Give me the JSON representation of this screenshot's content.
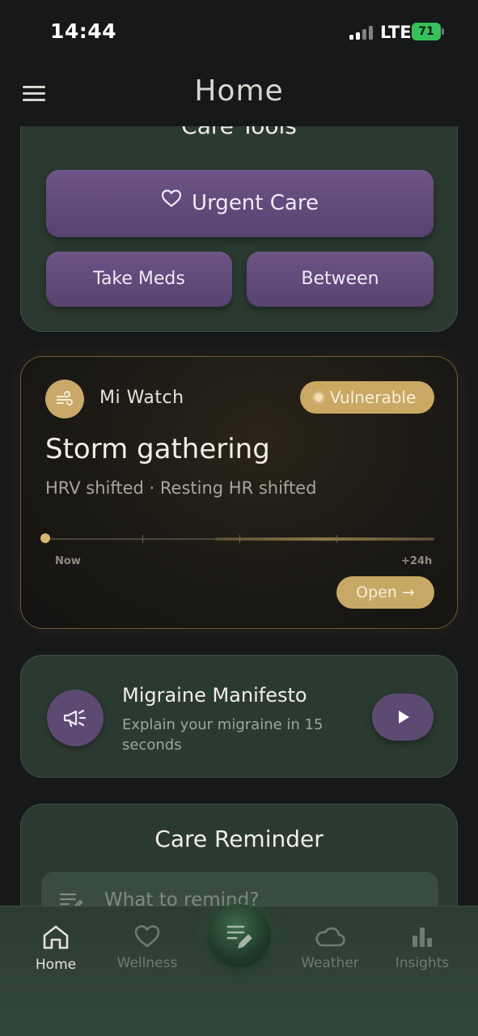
{
  "status_bar": {
    "time": "14:44",
    "network": "LTE",
    "battery": "71"
  },
  "header": {
    "title": "Home",
    "menu_icon": "hamburger-menu-icon"
  },
  "care_tools": {
    "title": "Care Tools",
    "urgent_label": "Urgent Care",
    "urgent_icon": "heart-icon",
    "meds_label": "Take Meds",
    "between_label": "Between"
  },
  "watch": {
    "device": "Mi Watch",
    "icon": "wind-icon",
    "status": "Vulnerable",
    "title": "Storm gathering",
    "subtitle": "HRV shifted · Resting HR shifted",
    "timeline_start": "Now",
    "timeline_end": "+24h",
    "open_label": "Open →"
  },
  "manifesto": {
    "title": "Migraine Manifesto",
    "subtitle": "Explain your migraine in 15 seconds",
    "icon": "megaphone-icon",
    "play_icon": "play-icon"
  },
  "reminder": {
    "title": "Care Reminder",
    "placeholder": "What to remind?",
    "icon": "list-edit-icon"
  },
  "nav": {
    "home": "Home",
    "wellness": "Wellness",
    "weather": "Weather",
    "insights": "Insights",
    "fab_icon": "journal-edit-icon"
  },
  "colors": {
    "background": "#17181a",
    "card_green": "#2b3a30",
    "accent_purple": "#5c4a73",
    "accent_gold": "#c8a865"
  }
}
